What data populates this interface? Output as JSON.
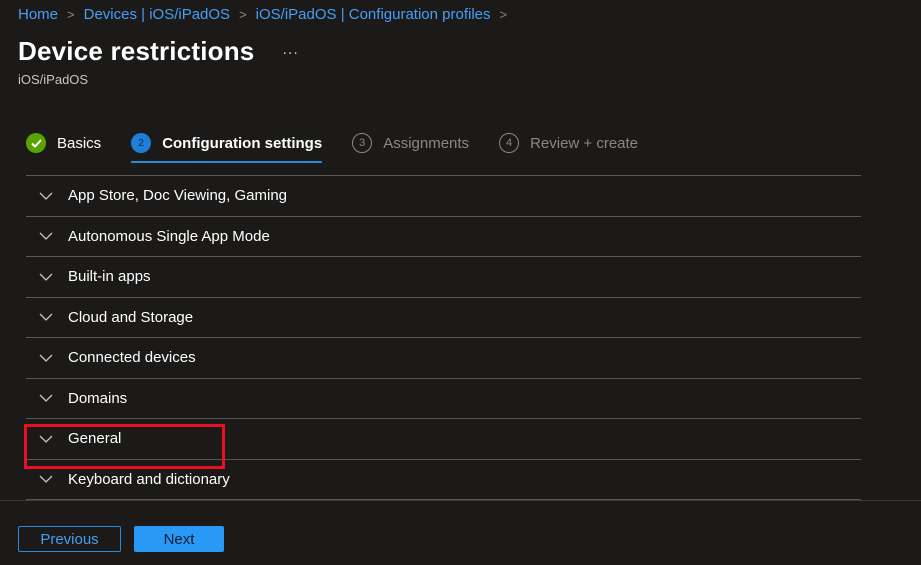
{
  "breadcrumb": [
    {
      "label": "Home"
    },
    {
      "label": "Devices | iOS/iPadOS"
    },
    {
      "label": "iOS/iPadOS | Configuration profiles"
    }
  ],
  "header": {
    "title": "Device restrictions",
    "more_label": "...",
    "subtitle": "iOS/iPadOS"
  },
  "wizard": {
    "steps": [
      {
        "number": "✓",
        "label": "Basics",
        "state": "completed"
      },
      {
        "number": "2",
        "label": "Configuration settings",
        "state": "active"
      },
      {
        "number": "3",
        "label": "Assignments",
        "state": "pending"
      },
      {
        "number": "4",
        "label": "Review + create",
        "state": "pending"
      }
    ]
  },
  "sections": [
    {
      "label": "App Store, Doc Viewing, Gaming"
    },
    {
      "label": "Autonomous Single App Mode"
    },
    {
      "label": "Built-in apps"
    },
    {
      "label": "Cloud and Storage"
    },
    {
      "label": "Connected devices"
    },
    {
      "label": "Domains"
    },
    {
      "label": "General",
      "highlighted": true
    },
    {
      "label": "Keyboard and dictionary"
    }
  ],
  "footer": {
    "previous_label": "Previous",
    "next_label": "Next"
  },
  "colors": {
    "accent": "#479ef5",
    "success": "#57a300",
    "highlight": "#e81123"
  }
}
